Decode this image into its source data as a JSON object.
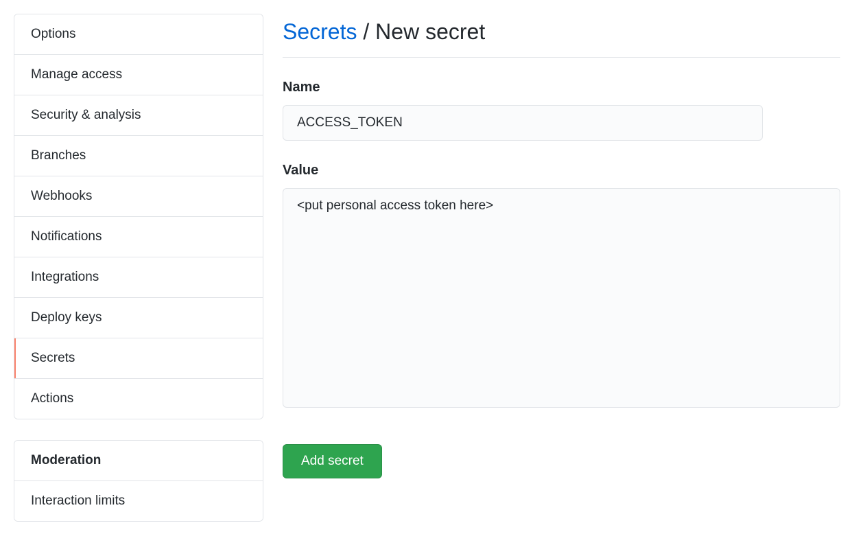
{
  "sidebar": {
    "group1": {
      "items": [
        {
          "label": "Options"
        },
        {
          "label": "Manage access"
        },
        {
          "label": "Security & analysis"
        },
        {
          "label": "Branches"
        },
        {
          "label": "Webhooks"
        },
        {
          "label": "Notifications"
        },
        {
          "label": "Integrations"
        },
        {
          "label": "Deploy keys"
        },
        {
          "label": "Secrets"
        },
        {
          "label": "Actions"
        }
      ]
    },
    "group2": {
      "header": "Moderation",
      "items": [
        {
          "label": "Interaction limits"
        }
      ]
    }
  },
  "breadcrumb": {
    "root": "Secrets",
    "separator": " / ",
    "current": "New secret"
  },
  "form": {
    "name": {
      "label": "Name",
      "value": "ACCESS_TOKEN"
    },
    "value": {
      "label": "Value",
      "value": "<put personal access token here>"
    },
    "submit_label": "Add secret"
  }
}
